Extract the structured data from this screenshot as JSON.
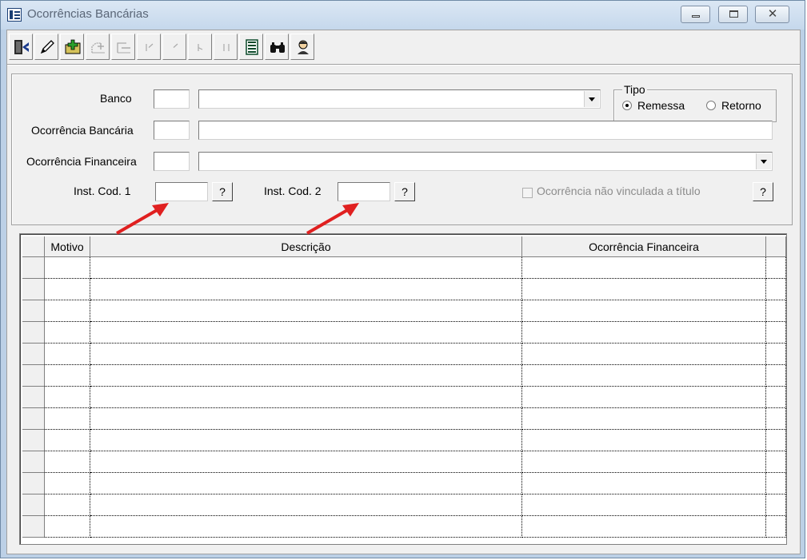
{
  "window": {
    "title": "Ocorrências Bancárias"
  },
  "titlebar": {
    "minimize_icon": "minimize-icon",
    "maximize_icon": "maximize-icon",
    "close_icon": "close-icon"
  },
  "toolbar": {
    "buttons": [
      {
        "name": "exit-button",
        "icon": "exit-door-icon",
        "enabled": true
      },
      {
        "name": "edit-button",
        "icon": "pencil-icon",
        "enabled": true
      },
      {
        "name": "new-button",
        "icon": "folder-add-icon",
        "enabled": true
      },
      {
        "name": "add-record-button",
        "icon": "add-record-icon",
        "enabled": false
      },
      {
        "name": "remove-record-button",
        "icon": "remove-record-icon",
        "enabled": false
      },
      {
        "name": "first-record-button",
        "icon": "first-record-icon",
        "enabled": false
      },
      {
        "name": "previous-record-button",
        "icon": "previous-record-icon",
        "enabled": false
      },
      {
        "name": "next-record-button",
        "icon": "next-record-icon",
        "enabled": false
      },
      {
        "name": "last-record-button",
        "icon": "last-record-icon",
        "enabled": false
      },
      {
        "name": "list-button",
        "icon": "list-icon",
        "enabled": true
      },
      {
        "name": "search-button",
        "icon": "binoculars-icon",
        "enabled": true
      },
      {
        "name": "help-button",
        "icon": "user-help-icon",
        "enabled": true
      }
    ]
  },
  "form": {
    "banco_label": "Banco",
    "ocorrencia_bancaria_label": "Ocorrência Bancária",
    "ocorrencia_financeira_label": "Ocorrência Financeira",
    "inst_cod1_label": "Inst. Cod. 1",
    "inst_cod2_label": "Inst. Cod. 2",
    "lookup_button_label": "?",
    "checkbox_label": "Ocorrência não vinculada a título",
    "tipo": {
      "legend": "Tipo",
      "options": [
        "Remessa",
        "Retorno"
      ],
      "selected": "Remessa"
    }
  },
  "grid": {
    "columns": [
      "Motivo",
      "Descrição",
      "Ocorrência Financeira"
    ],
    "rows": 13
  },
  "colors": {
    "titlebar": "#c5d8ec",
    "window_border": "#bcd0e6",
    "face": "#f0f0f0",
    "arrow": "#e02020"
  }
}
